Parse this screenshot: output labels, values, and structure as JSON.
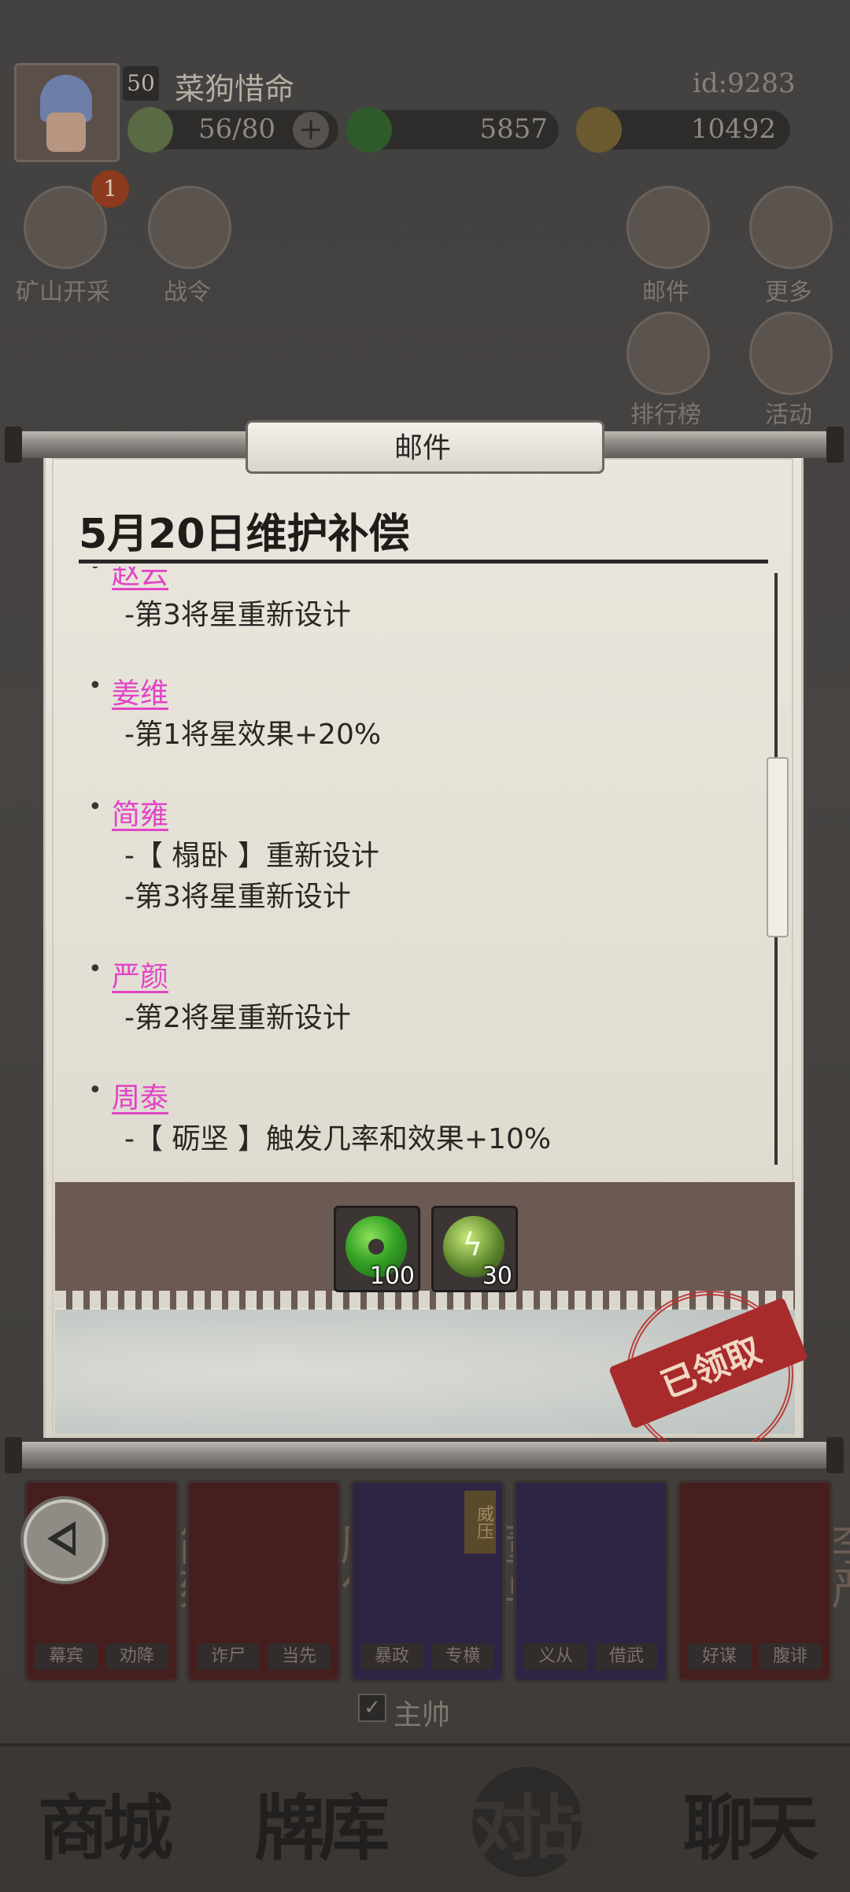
{
  "player": {
    "level": "50",
    "name": "菜狗惜命",
    "id": "id:9283",
    "energy": "56/80",
    "energy_plus": "+",
    "jade": "5857",
    "coins": "10492"
  },
  "side_menu": {
    "mining": "矿山开采",
    "mining_badge": "1",
    "battle_pass": "战令",
    "mail": "邮件",
    "more": "更多",
    "ranking": "排行榜",
    "activity": "活动"
  },
  "mail_modal": {
    "header": "邮件",
    "title": "5月20日维护补偿",
    "entries": [
      {
        "hero": "赵云",
        "lines": [
          "-第3将星重新设计"
        ]
      },
      {
        "hero": "姜维",
        "lines": [
          "-第1将星效果+20%"
        ]
      },
      {
        "hero": "简雍",
        "lines": [
          "-【 榻卧 】重新设计",
          "-第3将星重新设计"
        ]
      },
      {
        "hero": "严颜",
        "lines": [
          "-第2将星重新设计"
        ]
      },
      {
        "hero": "周泰",
        "lines": [
          "-【 砺坚 】触发几率和效果+10%"
        ]
      }
    ],
    "rewards": [
      {
        "icon": "jade-coin-icon",
        "qty": "100"
      },
      {
        "icon": "energy-icon",
        "qty": "30"
      }
    ],
    "claimed_stamp": "已领取"
  },
  "cards": [
    {
      "name": "简雍",
      "tags": [
        "幕宾",
        "劝降"
      ]
    },
    {
      "name": "廖化",
      "tags": [
        "诈尸",
        "当先"
      ]
    },
    {
      "name": "董卓",
      "tags": [
        "暴政",
        "专横"
      ],
      "badge": "威压"
    },
    {
      "name": "公孙瓒",
      "tags": [
        "义从",
        "借武"
      ]
    },
    {
      "name": "李严",
      "tags": [
        "好谋",
        "腹诽"
      ]
    }
  ],
  "commander_label": "主帅",
  "bottom_nav": [
    "商城",
    "牌库",
    "对战",
    "聊天"
  ],
  "colors": {
    "hero_link": "#e244c6",
    "stamp": "#a82b2b",
    "paper": "#e6e2d8"
  }
}
